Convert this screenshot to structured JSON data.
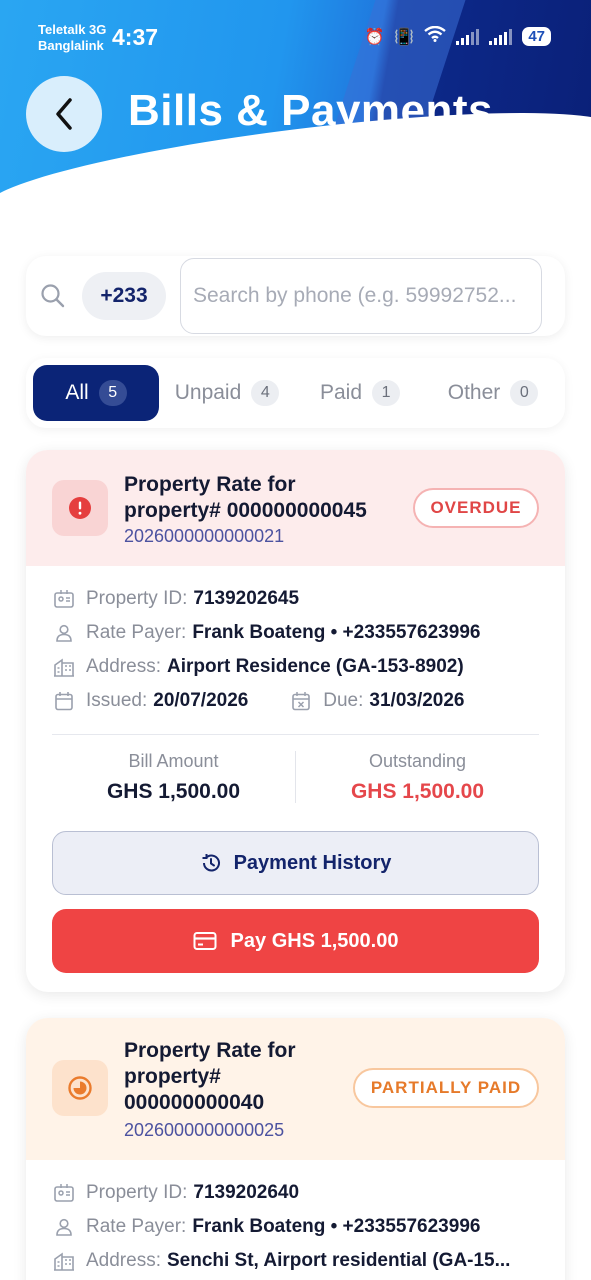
{
  "status_bar": {
    "carrier_1": "Teletalk 3G",
    "carrier_2": "Banglalink",
    "time": "4:37",
    "battery": "47"
  },
  "header": {
    "title": "Bills & Payments",
    "back_icon": "chevron-left-icon"
  },
  "search": {
    "country_code": "+233",
    "placeholder": "Search by phone (e.g. 59992752..."
  },
  "tabs": [
    {
      "label": "All",
      "count": "5",
      "active": true
    },
    {
      "label": "Unpaid",
      "count": "4",
      "active": false
    },
    {
      "label": "Paid",
      "count": "1",
      "active": false
    },
    {
      "label": "Other",
      "count": "0",
      "active": false
    }
  ],
  "bills": [
    {
      "title_line1": "Property Rate for",
      "title_line2": "property# 000000000045",
      "reference": "2026000000000021",
      "status": "OVERDUE",
      "status_color": "#e04646",
      "property_id_label": "Property ID:",
      "property_id": "7139202645",
      "rate_payer_label": "Rate Payer:",
      "rate_payer": "Frank Boateng • +233557623996",
      "address_label": "Address:",
      "address": "Airport Residence (GA-153-8902)",
      "issued_label": "Issued:",
      "issued": "20/07/2026",
      "due_label": "Due:",
      "due": "31/03/2026",
      "bill_amount_label": "Bill Amount",
      "bill_amount": "GHS 1,500.00",
      "outstanding_label": "Outstanding",
      "outstanding": "GHS 1,500.00",
      "history_label": "Payment History",
      "pay_label": "Pay GHS 1,500.00"
    },
    {
      "title_line1": "Property Rate for",
      "title_line2": "property#",
      "title_line3": "000000000040",
      "reference": "2026000000000025",
      "status": "PARTIALLY PAID",
      "status_color": "#e67a2a",
      "property_id_label": "Property ID:",
      "property_id": "7139202640",
      "rate_payer_label": "Rate Payer:",
      "rate_payer": "Frank Boateng • +233557623996",
      "address_label": "Address:",
      "address": "Senchi St, Airport residential (GA-15..."
    }
  ]
}
